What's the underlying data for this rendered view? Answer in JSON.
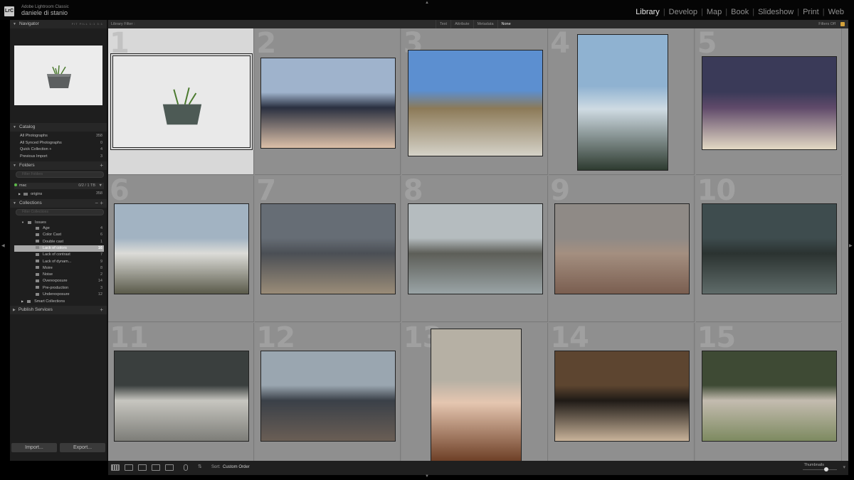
{
  "app": {
    "logo": "LrC",
    "name": "Adobe Lightroom Classic",
    "user": "daniele di stanio"
  },
  "modules": [
    {
      "label": "Library",
      "active": true
    },
    {
      "label": "Develop",
      "active": false
    },
    {
      "label": "Map",
      "active": false
    },
    {
      "label": "Book",
      "active": false
    },
    {
      "label": "Slideshow",
      "active": false
    },
    {
      "label": "Print",
      "active": false
    },
    {
      "label": "Web",
      "active": false
    }
  ],
  "navigator": {
    "title": "Navigator",
    "zoom": "FIT  FILL  1:1  3:1"
  },
  "catalog": {
    "title": "Catalog",
    "items": [
      {
        "label": "All Photographs",
        "count": "358"
      },
      {
        "label": "All Synced Photographs",
        "count": "0"
      },
      {
        "label": "Quick Collection +",
        "count": "4"
      },
      {
        "label": "Previous Import",
        "count": "3"
      }
    ]
  },
  "folders": {
    "title": "Folders",
    "filter_placeholder": "Filter Folders",
    "volume": "mac",
    "volume_info": "0/2 / 1 TB",
    "folder": "origins",
    "folder_count": "358"
  },
  "collections": {
    "title": "Collections",
    "filter_placeholder": "Filter Collections",
    "parent": "Issues",
    "items": [
      {
        "label": "Age",
        "count": "4"
      },
      {
        "label": "Color Cast",
        "count": "6"
      },
      {
        "label": "Double cast",
        "count": "1"
      },
      {
        "label": "Lack of colors",
        "count": "16",
        "selected": true
      },
      {
        "label": "Lack of contrast",
        "count": "7"
      },
      {
        "label": "Lack of dynam...",
        "count": "9"
      },
      {
        "label": "Moire",
        "count": "8"
      },
      {
        "label": "Noise",
        "count": "2"
      },
      {
        "label": "Overexposure",
        "count": "14"
      },
      {
        "label": "Pre-production",
        "count": "3"
      },
      {
        "label": "Underexposure",
        "count": "12"
      }
    ],
    "smart": "Smart Collections"
  },
  "publish": {
    "title": "Publish Services"
  },
  "buttons": {
    "import": "Import...",
    "export": "Export..."
  },
  "filter_bar": {
    "label": "Library Filter :",
    "tabs": [
      {
        "label": "Text",
        "active": false
      },
      {
        "label": "Attribute",
        "active": false
      },
      {
        "label": "Metadata",
        "active": false
      },
      {
        "label": "None",
        "active": true
      }
    ],
    "status": "Filters Off"
  },
  "grid": [
    {
      "num": "1",
      "desc": "concrete planter with grass",
      "colors": [
        "#e9e9e9",
        "#b8b8b8",
        "#4d5a55"
      ],
      "selected": true
    },
    {
      "num": "2",
      "desc": "pier at sunset over calm sea",
      "colors": [
        "#9fb3cc",
        "#dcc0a8",
        "#2a3040"
      ]
    },
    {
      "num": "3",
      "desc": "pilot with jet aircraft",
      "colors": [
        "#5c8fd0",
        "#d5d2c8",
        "#8c7a58"
      ]
    },
    {
      "num": "4",
      "desc": "waterfall over green cliffs",
      "colors": [
        "#8fb2d1",
        "#2e3b30",
        "#cfdbe3"
      ]
    },
    {
      "num": "5",
      "desc": "family photo in front of house",
      "colors": [
        "#3a3a58",
        "#e3d9c4",
        "#604a6a"
      ]
    },
    {
      "num": "6",
      "desc": "monument on coastal cliff",
      "colors": [
        "#a2b3c2",
        "#5a5a4a",
        "#dcdcd8"
      ]
    },
    {
      "num": "7",
      "desc": "stormy beach",
      "colors": [
        "#666d75",
        "#9a8c78",
        "#4b4f55"
      ]
    },
    {
      "num": "8",
      "desc": "seagulls over water",
      "colors": [
        "#b5bcbf",
        "#9aa4a6",
        "#5d5e58"
      ]
    },
    {
      "num": "9",
      "desc": "hazy canyon",
      "colors": [
        "#8f8a86",
        "#7a5e50",
        "#a48f80"
      ]
    },
    {
      "num": "10",
      "desc": "supercell storm over plain",
      "colors": [
        "#3e4c4e",
        "#5f6b69",
        "#2b3331"
      ]
    },
    {
      "num": "11",
      "desc": "seals on rocky shore",
      "colors": [
        "#3a3f3e",
        "#7d7d78",
        "#c7c6c0"
      ]
    },
    {
      "num": "12",
      "desc": "grand canal venice",
      "colors": [
        "#9aa6b0",
        "#6a5e55",
        "#3a4048"
      ]
    },
    {
      "num": "13",
      "desc": "portrait of woman",
      "colors": [
        "#b6b0a4",
        "#6a3b22",
        "#e5c6b0"
      ]
    },
    {
      "num": "14",
      "desc": "woman in elegant room",
      "colors": [
        "#5d4530",
        "#c9b39a",
        "#1f1a16"
      ]
    },
    {
      "num": "15",
      "desc": "donkeys in field",
      "colors": [
        "#3e4a34",
        "#7d8a60",
        "#c4bcb0"
      ]
    }
  ],
  "toolbar": {
    "sort_label": "Sort:",
    "sort_value": "Custom Order",
    "thumbnails_label": "Thumbnails",
    "icons": [
      "grid-view-icon",
      "loupe-view-icon",
      "compare-view-icon",
      "survey-view-icon",
      "people-view-icon",
      "painter-icon",
      "sort-direction-icon"
    ]
  }
}
